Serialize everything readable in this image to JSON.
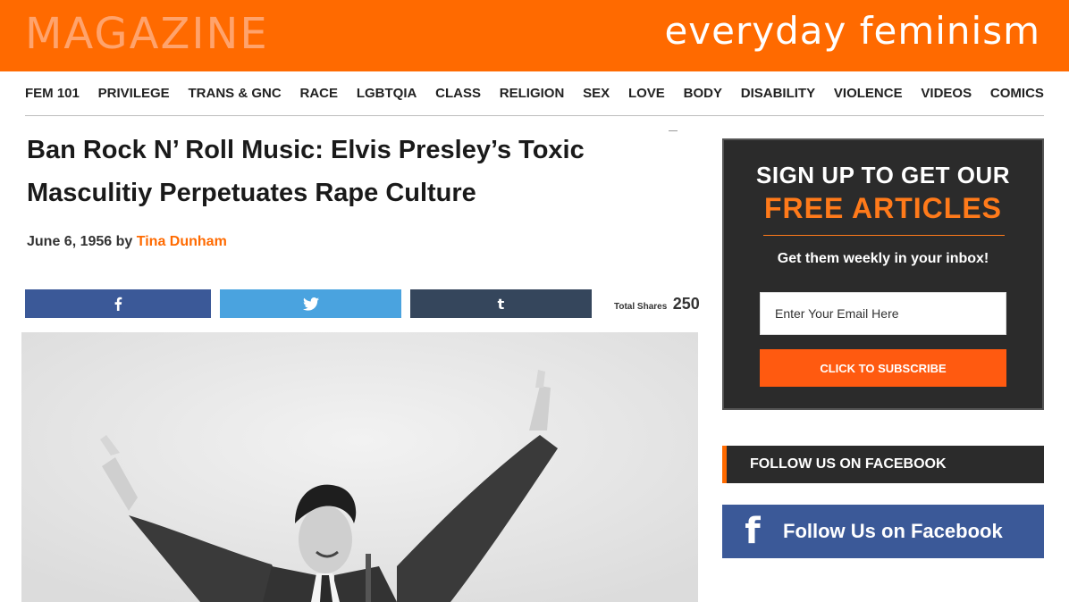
{
  "header": {
    "section_label": "MAGAZINE",
    "brand": "everyday feminism"
  },
  "nav": {
    "items": [
      "FEM 101",
      "PRIVILEGE",
      "TRANS & GNC",
      "RACE",
      "LGBTQIA",
      "CLASS",
      "RELIGION",
      "SEX",
      "LOVE",
      "BODY",
      "DISABILITY",
      "VIOLENCE",
      "VIDEOS",
      "COMICS"
    ]
  },
  "article": {
    "title": "Ban Rock N’ Roll Music: Elvis Presley’s Toxic Masculitiy Perpetuates Rape Culture",
    "date": "June 6, 1956",
    "by": "by",
    "author": "Tina Dunham",
    "author_color": "#ff6a00"
  },
  "share": {
    "facebook_icon": "facebook-icon",
    "twitter_icon": "twitter-icon",
    "tumblr_icon": "tumblr-icon",
    "total_label": "Total Shares",
    "total_count": "250"
  },
  "sidebar": {
    "signup": {
      "line1": "SIGN UP TO GET OUR",
      "line2": "FREE ARTICLES",
      "subtitle": "Get them weekly in your inbox!",
      "email_placeholder": "Enter Your Email Here",
      "button": "CLICK TO SUBSCRIBE"
    },
    "follow_heading": "FOLLOW US ON FACEBOOK",
    "facebook_button": "Follow Us on Facebook"
  },
  "colors": {
    "brand_orange": "#ff6a00",
    "facebook_blue": "#3b5998",
    "twitter_blue": "#4aa3df",
    "tumblr_navy": "#35465c"
  }
}
